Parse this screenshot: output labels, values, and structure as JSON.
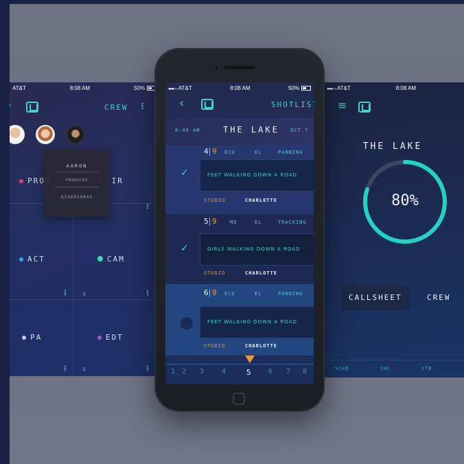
{
  "left_screen": {
    "status": {
      "carrier": "AT&T",
      "time": "8:08 AM",
      "battery": "50%"
    },
    "title": "CREW",
    "popup": {
      "name": "AARON",
      "role": "PRODUCER",
      "phone": "6150929845"
    },
    "roles": [
      {
        "label": "PROD",
        "color": "#e8367e"
      },
      {
        "label": "DIR",
        "color": "#8a6d4f"
      },
      {
        "label": "ACT",
        "color": "#2ea8e8"
      },
      {
        "label": "CAM",
        "color": "#3fe0a8"
      },
      {
        "label": "PA",
        "color": "#c9cdd6"
      },
      {
        "label": "EDT",
        "color": "#a45bc4"
      }
    ],
    "counts": [
      "4",
      "4"
    ]
  },
  "center_screen": {
    "status": {
      "carrier": "AT&T",
      "time": "8:08 AM",
      "battery": "50%"
    },
    "title": "SHOTLIST",
    "scene": {
      "time": "8:40 AM",
      "name": "THE LAKE",
      "date": "OCT 7"
    },
    "shots": [
      {
        "scene": "4",
        "take": "9",
        "shot": "ECU",
        "angle": "EL",
        "move": "PANNING",
        "desc": "FEET WALKING DOWN A ROAD",
        "location": "STUDIO",
        "name": "CHARLOTTE",
        "done": true
      },
      {
        "scene": "5",
        "take": "9",
        "shot": "MD",
        "angle": "EL",
        "move": "TRACKING",
        "desc": "GIRLS WALKING DOWN A ROAD",
        "location": "STUDIO",
        "name": "CHARLOTTE",
        "done": true
      },
      {
        "scene": "6",
        "take": "9",
        "shot": "ECU",
        "angle": "EL",
        "move": "PANNING",
        "desc": "FEET WALKING DOWN A ROAD",
        "location": "STUDIO",
        "name": "CHARLOTTE",
        "done": false
      }
    ],
    "timeline": [
      "1",
      "2",
      "3",
      "4",
      "5",
      "6",
      "7",
      "8",
      "9",
      "10"
    ],
    "timeline_selected": "5"
  },
  "right_screen": {
    "status": {
      "carrier": "AT&T",
      "time": "8:08 AM"
    },
    "title": "THE LAKE",
    "progress_percent": 80,
    "progress_label": "80%",
    "tabs": [
      "CALLSHEET",
      "CREW"
    ],
    "bottom_tabs": [
      "SCHD",
      "SHL",
      "STB"
    ]
  },
  "colors": {
    "accent": "#3fd6c7",
    "highlight": "#e99b33"
  }
}
